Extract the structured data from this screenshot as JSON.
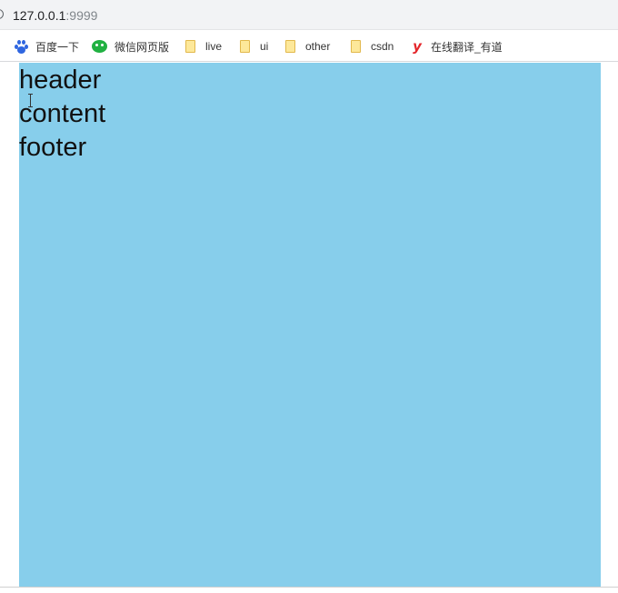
{
  "address_bar": {
    "host": "127.0.0.1",
    "port": ":9999",
    "icon": "info-circle-icon"
  },
  "bookmarks": [
    {
      "label": "百度一下",
      "icon": "baidu-paw-icon"
    },
    {
      "label": "微信网页版",
      "icon": "wechat-icon"
    },
    {
      "label": "live",
      "icon": "folder-icon"
    },
    {
      "label": "ui",
      "icon": "folder-icon"
    },
    {
      "label": "other",
      "icon": "folder-icon"
    },
    {
      "label": "csdn",
      "icon": "folder-icon"
    },
    {
      "label": "在线翻译_有道",
      "icon": "youdao-icon"
    }
  ],
  "page": {
    "header": "header",
    "content": "content",
    "footer": "footer",
    "background_color": "#87ceeb"
  }
}
